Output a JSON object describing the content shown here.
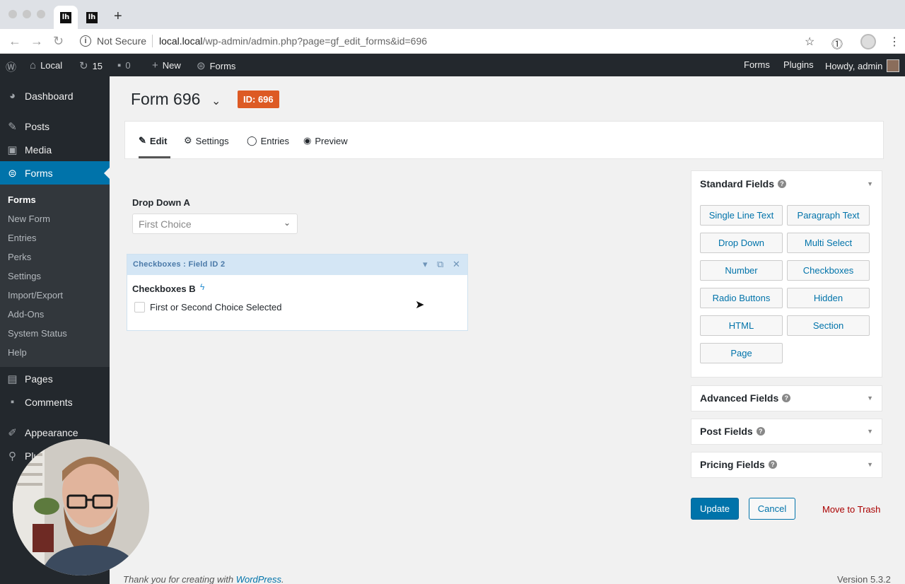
{
  "browser": {
    "tabs": [
      {
        "icon_text": "lh",
        "active": true
      },
      {
        "icon_text": "lh",
        "active": false
      }
    ],
    "security_label": "Not Secure",
    "url_host": "local.local",
    "url_path": "/wp-admin/admin.php?page=gf_edit_forms&id=696"
  },
  "adminbar": {
    "site_name": "Local",
    "updates_count": "15",
    "comments_count": "0",
    "new_label": "New",
    "forms_label": "Forms",
    "right_forms": "Forms",
    "right_plugins": "Plugins",
    "howdy": "Howdy, admin"
  },
  "sidebar": {
    "dashboard": "Dashboard",
    "posts": "Posts",
    "media": "Media",
    "forms": "Forms",
    "submenu": [
      "Forms",
      "New Form",
      "Entries",
      "Perks",
      "Settings",
      "Import/Export",
      "Add-Ons",
      "System Status",
      "Help"
    ],
    "pages": "Pages",
    "comments": "Comments",
    "appearance": "Appearance",
    "plugins_partial": "Plu"
  },
  "form": {
    "title": "Form 696",
    "id_badge": "ID: 696"
  },
  "toolbar": {
    "edit": "Edit",
    "settings": "Settings",
    "entries": "Entries",
    "preview": "Preview"
  },
  "fields": {
    "dropdown_label": "Drop Down A",
    "dropdown_value": "First Choice",
    "checkbox_header": "Checkboxes : Field ID 2",
    "checkbox_label": "Checkboxes B",
    "checkbox_option": "First or Second Choice Selected"
  },
  "panels": {
    "standard": "Standard Fields",
    "advanced": "Advanced Fields",
    "post": "Post Fields",
    "pricing": "Pricing Fields",
    "buttons": [
      "Single Line Text",
      "Paragraph Text",
      "Drop Down",
      "Multi Select",
      "Number",
      "Checkboxes",
      "Radio Buttons",
      "Hidden",
      "HTML",
      "Section",
      "Page"
    ]
  },
  "actions": {
    "update": "Update",
    "cancel": "Cancel",
    "trash": "Move to Trash"
  },
  "footer": {
    "thanks_prefix": "Thank you for creating with ",
    "thanks_link": "WordPress",
    "thanks_suffix": ".",
    "version": "Version 5.3.2"
  },
  "colors": {
    "wp_blue": "#0073aa",
    "admin_dark": "#23282d",
    "id_badge": "#dd5a24"
  }
}
